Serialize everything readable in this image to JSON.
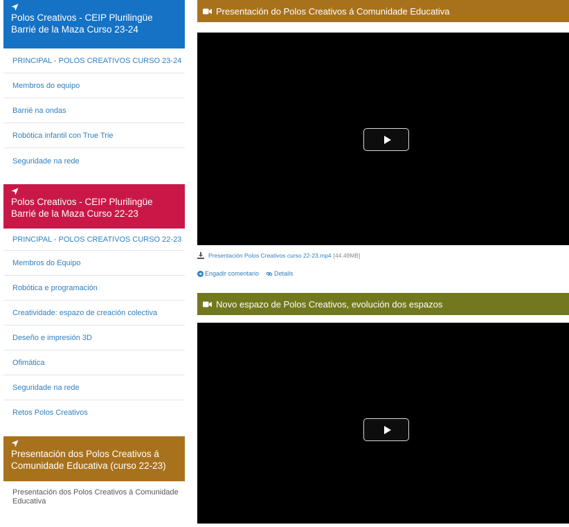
{
  "sidebar": {
    "blocks": [
      {
        "title": "Polos Creativos - CEIP Plurilingüe Barrié de la Maza Curso 23-24",
        "color": "#1572c5",
        "items": [
          "PRINCIPAL - POLOS CREATIVOS CURSO 23-24",
          "Membros do equipo",
          "Barrié na ondas",
          "Robótica infantil con True Trie",
          "Seguridade na rede"
        ]
      },
      {
        "title": "Polos Creativos - CEIP Plurilingüe Barrié de la Maza Curso 22-23",
        "color": "#c91848",
        "items": [
          "PRINCIPAL - POLOS CREATIVOS CURSO 22-23",
          "Membros do Equipo",
          "Robótica e programación",
          "Creatividade: espazo de creación colectiva",
          "Deseño e impresión 3D",
          "Ofimática",
          "Seguridade na rede",
          "Retos Polos Creativos"
        ]
      },
      {
        "title": "Presentación dos Polos Creativos á Comunidade Educativa (curso 22-23)",
        "color": "#a8721d",
        "items": [
          "Presentación dos Polos Creativos á Comunidade Educativa"
        ]
      }
    ],
    "nav_icon": "location-arrow-icon"
  },
  "main": {
    "videos": [
      {
        "title": "Presentación do Polos Creativos á Comunidade Educativa",
        "header_color": "#a8721d",
        "icon": "video-camera-icon",
        "file_name": "Presentación Polos Creativos curso 22-23.mp4",
        "file_size": "[44.49MB]",
        "comment_label": "Engadir comentario",
        "details_label": "Details"
      },
      {
        "title": "Novo espazo de Polos Creativos, evolución dos espazos",
        "header_color": "#72781e",
        "icon": "video-camera-icon"
      }
    ]
  },
  "colors": {
    "link": "#2f7fc0",
    "video_bg": "#000000"
  }
}
